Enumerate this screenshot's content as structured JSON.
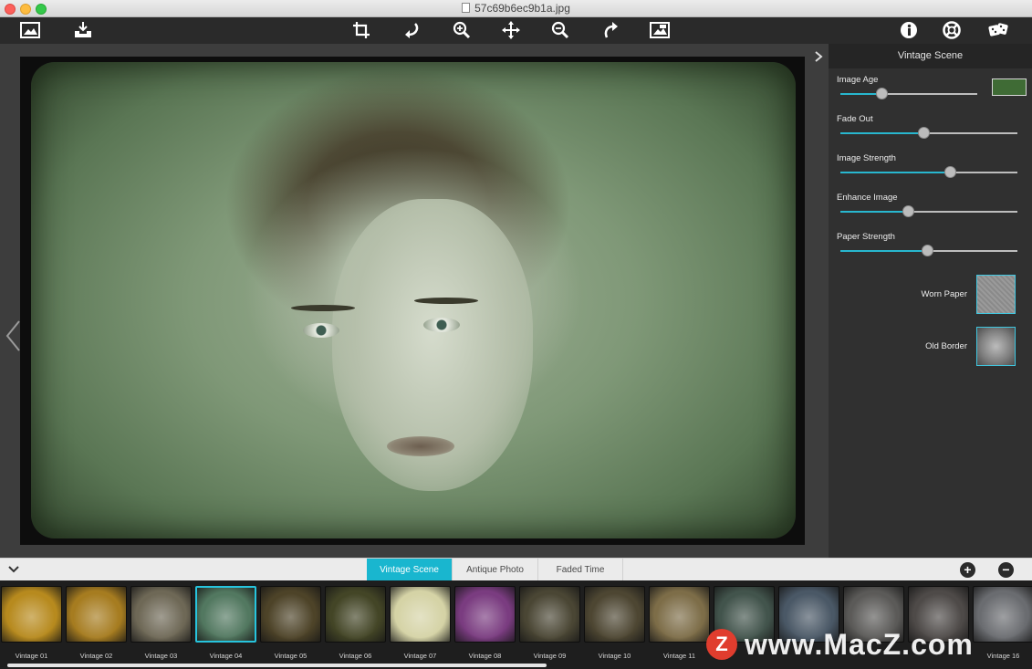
{
  "window": {
    "title": "57c69b6ec9b1a.jpg"
  },
  "toolbar": {
    "left": [
      {
        "name": "open-image-icon"
      },
      {
        "name": "save-export-icon"
      }
    ],
    "center": [
      {
        "name": "crop-icon"
      },
      {
        "name": "rotate-left-icon"
      },
      {
        "name": "zoom-in-icon"
      },
      {
        "name": "move-pan-icon"
      },
      {
        "name": "zoom-out-icon"
      },
      {
        "name": "rotate-right-icon"
      },
      {
        "name": "compare-original-icon"
      }
    ],
    "right": [
      {
        "name": "info-icon"
      },
      {
        "name": "help-lifebuoy-icon"
      },
      {
        "name": "random-dice-icon"
      }
    ]
  },
  "panel": {
    "title": "Vintage Scene",
    "params": [
      {
        "label": "Image Age",
        "value": 0.3,
        "has_color": true,
        "color": "#3f6b35"
      },
      {
        "label": "Fade Out",
        "value": 0.47
      },
      {
        "label": "Image Strength",
        "value": 0.62
      },
      {
        "label": "Enhance Image",
        "value": 0.38
      },
      {
        "label": "Paper Strength",
        "value": 0.49
      }
    ],
    "textures": [
      {
        "label": "Worn Paper"
      },
      {
        "label": "Old Border"
      }
    ]
  },
  "tabs": [
    {
      "label": "Vintage Scene",
      "active": true
    },
    {
      "label": "Antique Photo",
      "active": false
    },
    {
      "label": "Faded Time",
      "active": false
    }
  ],
  "presets": [
    {
      "label": "Vintage 01",
      "tone": "#b78a1e"
    },
    {
      "label": "Vintage 02",
      "tone": "#a67c20"
    },
    {
      "label": "Vintage 03",
      "tone": "#6e6856"
    },
    {
      "label": "Vintage 04",
      "tone": "#527860",
      "selected": true
    },
    {
      "label": "Vintage 05",
      "tone": "#4d4328"
    },
    {
      "label": "Vintage 06",
      "tone": "#434526"
    },
    {
      "label": "Vintage 07",
      "tone": "#d5d3a6"
    },
    {
      "label": "Vintage 08",
      "tone": "#7a3c80"
    },
    {
      "label": "Vintage 09",
      "tone": "#4a4634"
    },
    {
      "label": "Vintage 10",
      "tone": "#4d4632"
    },
    {
      "label": "Vintage 11",
      "tone": "#7d6d48"
    },
    {
      "label": "",
      "tone": "#42544c"
    },
    {
      "label": "",
      "tone": "#4a5866"
    },
    {
      "label": "",
      "tone": "#5b5a58"
    },
    {
      "label": "",
      "tone": "#4e4a48"
    },
    {
      "label": "Vintage 16",
      "tone": "#6a6c70"
    }
  ],
  "watermark": {
    "logo": "Z",
    "text": "www.MacZ.com"
  },
  "colors": {
    "accent": "#19b6cf",
    "selection": "#27c4dd"
  }
}
